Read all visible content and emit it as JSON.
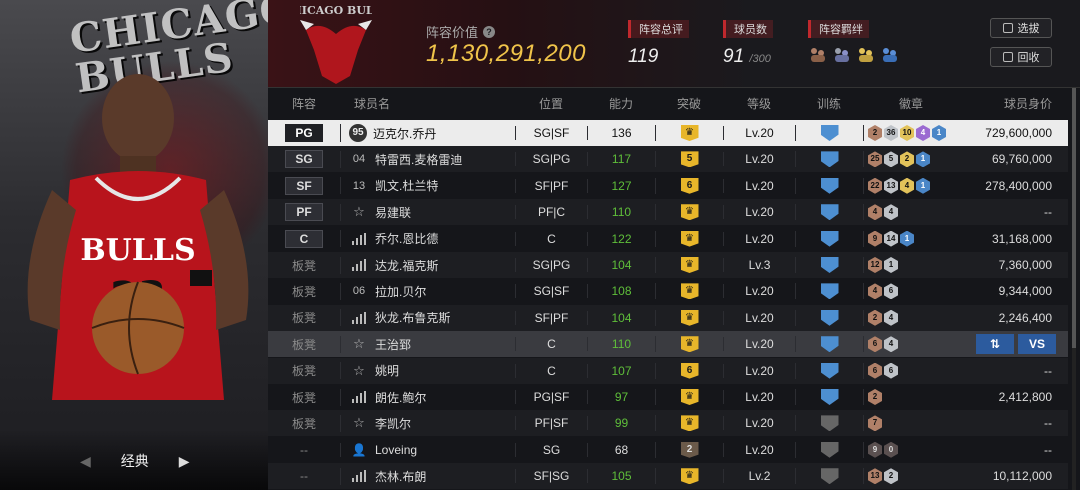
{
  "hero": {
    "team_word": "CHICAGO BULLS",
    "nav_label": "经典"
  },
  "header": {
    "logo_text": "CHICAGO BULLS",
    "value_label": "阵容价值",
    "value": "1,130,291,200",
    "stats": [
      {
        "tag": "阵容总评",
        "value": "119"
      },
      {
        "tag": "球员数",
        "value": "91",
        "sub": "/300"
      },
      {
        "tag": "阵容羁绊"
      }
    ],
    "buttons": {
      "pick": "选拔",
      "recycle": "回收"
    }
  },
  "table": {
    "columns": [
      "阵容",
      "球员名",
      "位置",
      "能力",
      "突破",
      "等级",
      "训练",
      "徽章",
      "球员身价"
    ],
    "rows": [
      {
        "slot": "PG",
        "slot_kind": "tag",
        "ico": "95",
        "ico_kind": "circle",
        "name": "迈克尔.乔丹",
        "pos": "SG|SF",
        "ability": "136",
        "green": false,
        "brk": "",
        "brk_kind": "gold",
        "lvl": "Lv.20",
        "train": "blue",
        "badges": [
          [
            "bronze",
            "2"
          ],
          [
            "silver",
            "36"
          ],
          [
            "gold",
            "10"
          ],
          [
            "purple",
            "4"
          ],
          [
            "blue",
            "1"
          ]
        ],
        "value": "729,600,000",
        "style": "sel"
      },
      {
        "slot": "SG",
        "slot_kind": "tag",
        "ico": "04",
        "ico_kind": "num",
        "name": "特雷西.麦格雷迪",
        "pos": "SG|PG",
        "ability": "117",
        "green": true,
        "brk": "5",
        "brk_kind": "gold",
        "lvl": "Lv.20",
        "train": "blue",
        "badges": [
          [
            "bronze",
            "25"
          ],
          [
            "silver",
            "5"
          ],
          [
            "gold",
            "2"
          ],
          [
            "blue",
            "1"
          ]
        ],
        "value": "69,760,000",
        "style": "alt"
      },
      {
        "slot": "SF",
        "slot_kind": "tag",
        "ico": "13",
        "ico_kind": "num",
        "name": "凯文.杜兰特",
        "pos": "SF|PF",
        "ability": "127",
        "green": true,
        "brk": "6",
        "brk_kind": "gold",
        "lvl": "Lv.20",
        "train": "blue",
        "badges": [
          [
            "bronze",
            "22"
          ],
          [
            "silver",
            "13"
          ],
          [
            "gold",
            "4"
          ],
          [
            "blue",
            "1"
          ]
        ],
        "value": "278,400,000",
        "style": ""
      },
      {
        "slot": "PF",
        "slot_kind": "tag",
        "ico": "star",
        "ico_kind": "star",
        "name": "易建联",
        "pos": "PF|C",
        "ability": "110",
        "green": true,
        "brk": "",
        "brk_kind": "gold",
        "lvl": "Lv.20",
        "train": "blue",
        "badges": [
          [
            "bronze",
            "4"
          ],
          [
            "silver",
            "4"
          ]
        ],
        "value": "--",
        "style": "alt"
      },
      {
        "slot": "C",
        "slot_kind": "tag",
        "ico": "bars",
        "ico_kind": "bars",
        "name": "乔尔.恩比德",
        "pos": "C",
        "ability": "122",
        "green": true,
        "brk": "",
        "brk_kind": "gold",
        "lvl": "Lv.20",
        "train": "blue",
        "badges": [
          [
            "bronze",
            "9"
          ],
          [
            "silver",
            "14"
          ],
          [
            "blue",
            "1"
          ]
        ],
        "value": "31,168,000",
        "style": ""
      },
      {
        "slot": "板凳",
        "slot_kind": "bench",
        "ico": "bars",
        "ico_kind": "bars",
        "name": "达龙.福克斯",
        "pos": "SG|PG",
        "ability": "104",
        "green": true,
        "brk": "",
        "brk_kind": "gold",
        "lvl": "Lv.3",
        "train": "blue",
        "badges": [
          [
            "bronze",
            "12"
          ],
          [
            "silver",
            "1"
          ]
        ],
        "value": "7,360,000",
        "style": "alt"
      },
      {
        "slot": "板凳",
        "slot_kind": "bench",
        "ico": "06",
        "ico_kind": "num",
        "name": "拉加.贝尔",
        "pos": "SG|SF",
        "ability": "108",
        "green": true,
        "brk": "",
        "brk_kind": "gold",
        "lvl": "Lv.20",
        "train": "blue",
        "badges": [
          [
            "bronze",
            "4"
          ],
          [
            "silver",
            "6"
          ]
        ],
        "value": "9,344,000",
        "style": ""
      },
      {
        "slot": "板凳",
        "slot_kind": "bench",
        "ico": "bars",
        "ico_kind": "bars",
        "name": "狄龙.布鲁克斯",
        "pos": "SF|PF",
        "ability": "104",
        "green": true,
        "brk": "",
        "brk_kind": "gold",
        "lvl": "Lv.20",
        "train": "blue",
        "badges": [
          [
            "bronze",
            "2"
          ],
          [
            "silver",
            "4"
          ]
        ],
        "value": "2,246,400",
        "style": "alt"
      },
      {
        "slot": "板凳",
        "slot_kind": "bench",
        "ico": "star",
        "ico_kind": "star",
        "name": "王治郅",
        "pos": "C",
        "ability": "110",
        "green": true,
        "brk": "",
        "brk_kind": "gold",
        "lvl": "Lv.20",
        "train": "blue",
        "badges": [
          [
            "bronze",
            "6"
          ],
          [
            "silver",
            "4"
          ]
        ],
        "value": "",
        "style": "hl",
        "vs": true
      },
      {
        "slot": "板凳",
        "slot_kind": "bench",
        "ico": "star",
        "ico_kind": "star",
        "name": "姚明",
        "pos": "C",
        "ability": "107",
        "green": true,
        "brk": "6",
        "brk_kind": "gold",
        "lvl": "Lv.20",
        "train": "blue",
        "badges": [
          [
            "bronze",
            "6"
          ],
          [
            "silver",
            "6"
          ]
        ],
        "value": "--",
        "style": "alt"
      },
      {
        "slot": "板凳",
        "slot_kind": "bench",
        "ico": "bars",
        "ico_kind": "bars",
        "name": "朗佐.鲍尔",
        "pos": "PG|SF",
        "ability": "97",
        "green": true,
        "brk": "",
        "brk_kind": "gold",
        "lvl": "Lv.20",
        "train": "blue",
        "badges": [
          [
            "bronze",
            "2"
          ]
        ],
        "value": "2,412,800",
        "style": ""
      },
      {
        "slot": "板凳",
        "slot_kind": "bench",
        "ico": "star",
        "ico_kind": "star",
        "name": "李凯尔",
        "pos": "PF|SF",
        "ability": "99",
        "green": true,
        "brk": "",
        "brk_kind": "gold",
        "lvl": "Lv.20",
        "train": "grey",
        "badges": [
          [
            "bronze",
            "7"
          ]
        ],
        "value": "--",
        "style": "alt"
      },
      {
        "slot": "--",
        "slot_kind": "bench",
        "ico": "person",
        "ico_kind": "person",
        "name": "Loveing",
        "pos": "SG",
        "ability": "68",
        "green": false,
        "brk": "2",
        "brk_kind": "grey",
        "lvl": "Lv.20",
        "train": "grey",
        "badges": [
          [
            "dark",
            "9"
          ],
          [
            "dark",
            "0"
          ]
        ],
        "value": "--",
        "style": ""
      },
      {
        "slot": "--",
        "slot_kind": "bench",
        "ico": "bars",
        "ico_kind": "bars",
        "name": "杰林.布朗",
        "pos": "SF|SG",
        "ability": "105",
        "green": true,
        "brk": "",
        "brk_kind": "gold",
        "lvl": "Lv.2",
        "train": "grey",
        "badges": [
          [
            "bronze",
            "13"
          ],
          [
            "silver",
            "2"
          ]
        ],
        "value": "10,112,000",
        "style": "alt"
      }
    ],
    "vs_buttons": [
      "⇅",
      "VS"
    ]
  }
}
